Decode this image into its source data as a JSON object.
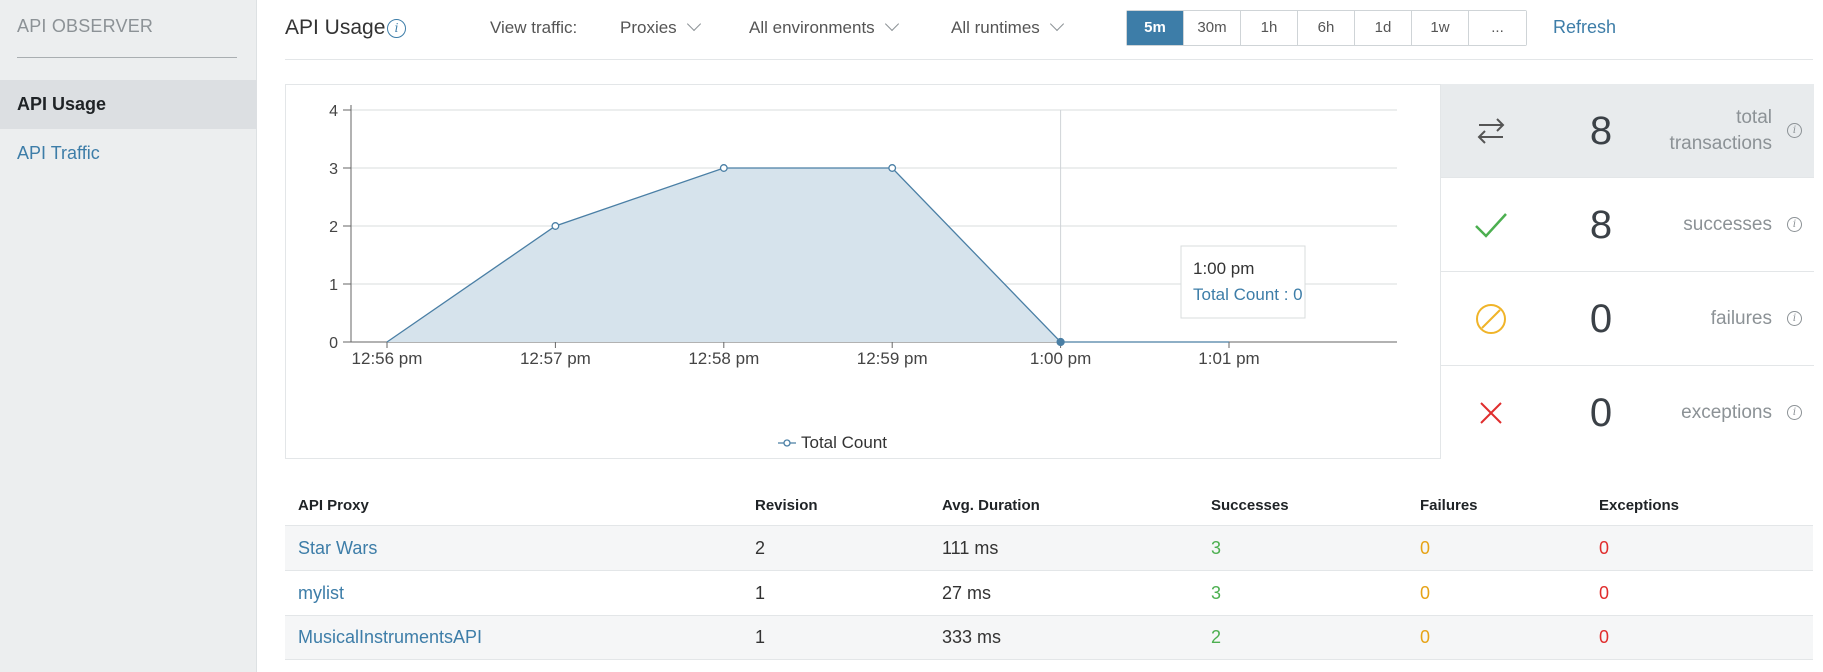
{
  "sidebar": {
    "brand": "API OBSERVER",
    "items": [
      {
        "label": "API Usage",
        "active": true
      },
      {
        "label": "API Traffic",
        "active": false
      }
    ]
  },
  "header": {
    "title": "API Usage",
    "view_label": "View traffic:",
    "dropdowns": [
      "Proxies",
      "All environments",
      "All runtimes"
    ],
    "ranges": [
      "5m",
      "30m",
      "1h",
      "6h",
      "1d",
      "1w",
      "..."
    ],
    "active_range": "5m",
    "refresh": "Refresh"
  },
  "chart_data": {
    "type": "area",
    "x": [
      "12:56 pm",
      "12:57 pm",
      "12:58 pm",
      "12:59 pm",
      "1:00 pm",
      "1:01 pm"
    ],
    "series": [
      {
        "name": "Total Count",
        "values": [
          0,
          2,
          3,
          3,
          0,
          0
        ]
      }
    ],
    "ylim": [
      0,
      4
    ],
    "yticks": [
      0,
      1,
      2,
      3,
      4
    ],
    "grid": true,
    "legend": "bottom",
    "tooltip": {
      "title": "1:00 pm",
      "text": "Total Count : 0"
    },
    "colors": {
      "line": "#4a7fa5",
      "fill": "#d6e3ec"
    }
  },
  "stats": [
    {
      "value": "8",
      "label_line1": "total",
      "label_line2": "transactions",
      "icon": "transfer-icon",
      "color": "#555555"
    },
    {
      "value": "8",
      "label_line1": "successes",
      "label_line2": "",
      "icon": "check-icon",
      "color": "#4caf50"
    },
    {
      "value": "0",
      "label_line1": "failures",
      "label_line2": "",
      "icon": "ban-icon",
      "color": "#f0b429"
    },
    {
      "value": "0",
      "label_line1": "exceptions",
      "label_line2": "",
      "icon": "x-icon",
      "color": "#e02d2d"
    }
  ],
  "table": {
    "headers": [
      "API Proxy",
      "Revision",
      "Avg. Duration",
      "Successes",
      "Failures",
      "Exceptions"
    ],
    "rows": [
      {
        "proxy": "Star Wars",
        "revision": "2",
        "duration": "111 ms",
        "successes": "3",
        "failures": "0",
        "exceptions": "0"
      },
      {
        "proxy": "mylist",
        "revision": "1",
        "duration": "27 ms",
        "successes": "3",
        "failures": "0",
        "exceptions": "0"
      },
      {
        "proxy": "MusicalInstrumentsAPI",
        "revision": "1",
        "duration": "333 ms",
        "successes": "2",
        "failures": "0",
        "exceptions": "0"
      }
    ]
  }
}
